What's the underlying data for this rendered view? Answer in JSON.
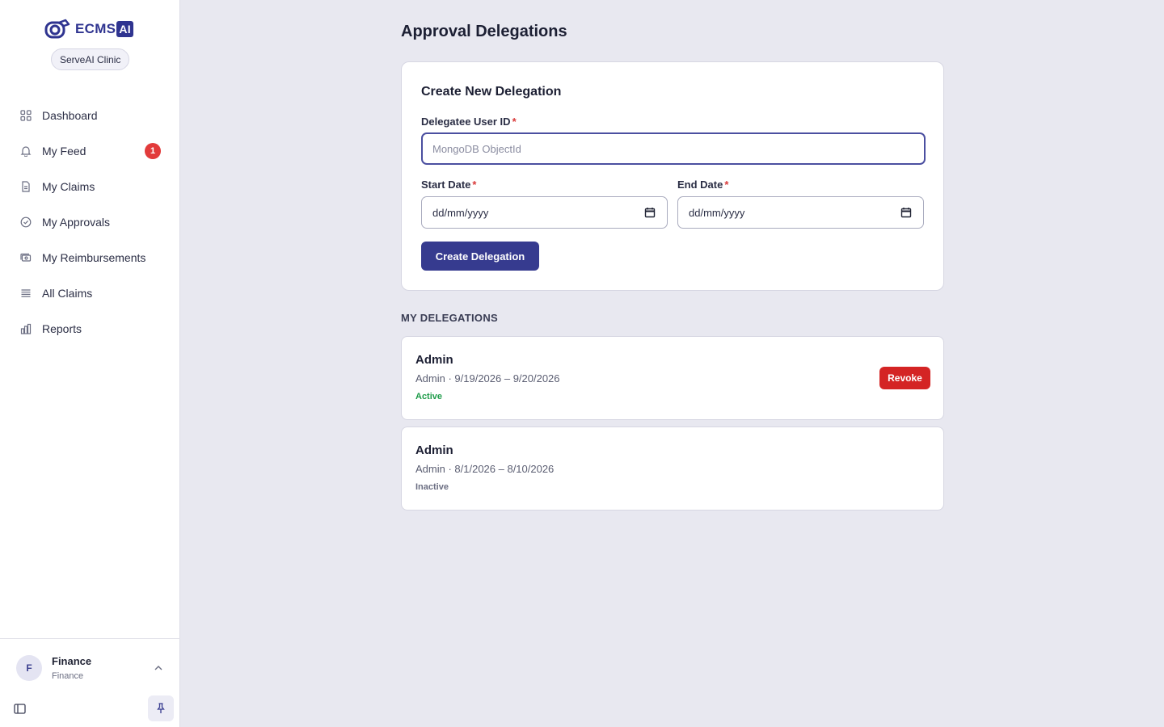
{
  "brand": {
    "name": "ECMS",
    "suffix": "AI",
    "color": "#2f3490"
  },
  "org": {
    "name": "ServeAI Clinic"
  },
  "sidebar": {
    "items": [
      {
        "label": "Dashboard",
        "icon": "grid-icon"
      },
      {
        "label": "My Feed",
        "icon": "bell-icon",
        "badge": "1"
      },
      {
        "label": "My Claims",
        "icon": "document-icon"
      },
      {
        "label": "My Approvals",
        "icon": "check-circle-icon"
      },
      {
        "label": "My Reimbursements",
        "icon": "money-icon"
      },
      {
        "label": "All Claims",
        "icon": "list-icon"
      },
      {
        "label": "Reports",
        "icon": "bar-chart-icon"
      }
    ]
  },
  "user": {
    "initial": "F",
    "name": "Finance",
    "role": "Finance"
  },
  "page": {
    "title": "Approval Delegations"
  },
  "form": {
    "title": "Create New Delegation",
    "delegatee_label": "Delegatee User ID",
    "delegatee_placeholder": "MongoDB ObjectId",
    "delegatee_value": "",
    "start_label": "Start Date",
    "start_value": "dd/mm/yyyy",
    "end_label": "End Date",
    "end_value": "dd/mm/yyyy",
    "required_mark": "*",
    "submit_label": "Create Delegation"
  },
  "delegations": {
    "heading": "MY DELEGATIONS",
    "items": [
      {
        "name": "Admin",
        "range": "Admin · 9/19/2026 – 9/20/2026",
        "status": "Active",
        "action": "Revoke"
      },
      {
        "name": "Admin",
        "range": "Admin · 8/1/2026 – 8/10/2026",
        "status": "Inactive"
      }
    ]
  },
  "colors": {
    "accent": "#363b8f",
    "danger": "#d42424",
    "active": "#1f9c4a",
    "badge": "#e23b3b"
  }
}
